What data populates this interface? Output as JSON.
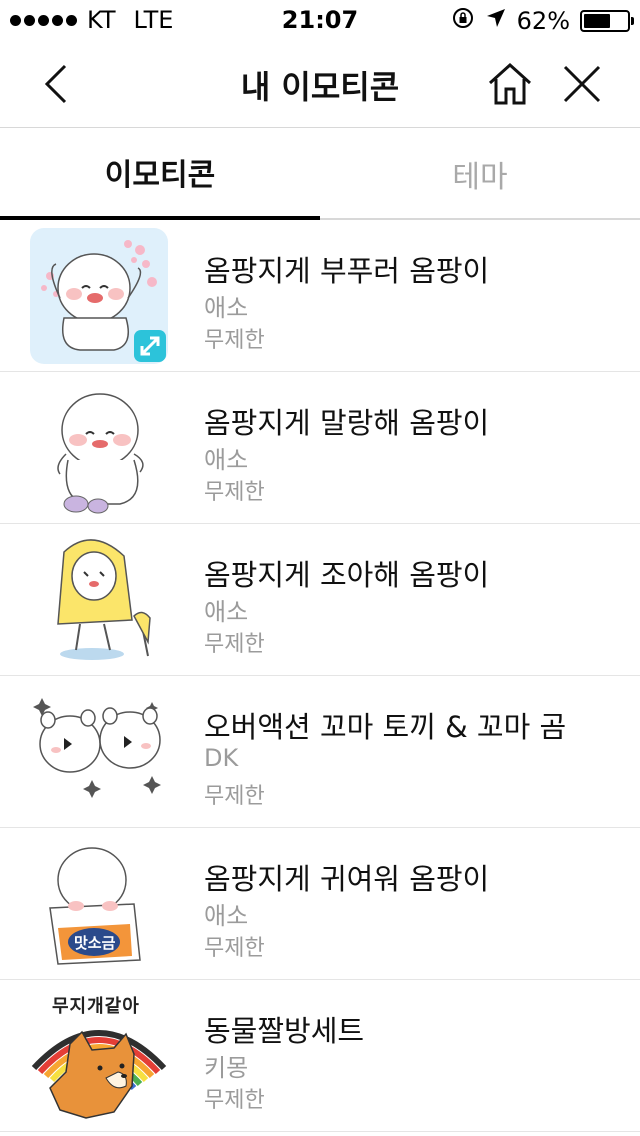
{
  "status_bar": {
    "carrier": "KT",
    "network": "LTE",
    "time": "21:07",
    "battery": "62%",
    "battery_level": 0.62
  },
  "nav": {
    "title": "내 이모티콘",
    "back_icon": "chevron-left-icon",
    "home_icon": "home-icon",
    "close_icon": "close-icon"
  },
  "tabs": [
    {
      "label": "이모티콘",
      "active": true
    },
    {
      "label": "테마",
      "active": false
    }
  ],
  "items": [
    {
      "title": "옴팡지게 부푸러 옴팡이",
      "author": "애소",
      "period": "무제한",
      "thumb": "ompang-puffed-sticker",
      "badge": "expand-icon"
    },
    {
      "title": "옴팡지게 말랑해 옴팡이",
      "author": "애소",
      "period": "무제한",
      "thumb": "ompang-soft-sticker"
    },
    {
      "title": "옴팡지게 조아해 옴팡이",
      "author": "애소",
      "period": "무제한",
      "thumb": "ompang-raincoat-sticker"
    },
    {
      "title": "오버액션 꼬마 토끼 & 꼬마 곰",
      "author": "DK",
      "period": "무제한",
      "thumb": "rabbit-bear-sticker"
    },
    {
      "title": "옴팡지게 귀여워 옴팡이",
      "author": "애소",
      "period": "무제한",
      "thumb": "ompang-bag-sticker",
      "thumb_text": "맛소금"
    },
    {
      "title": "동물짤방세트",
      "author": "키몽",
      "period": "무제한",
      "thumb": "dog-rainbow-sticker",
      "thumb_text": "무지개같아"
    }
  ],
  "colors": {
    "accent": "#000000",
    "text_primary": "#111111",
    "text_secondary": "#9b9b9b",
    "badge": "#2cc3da",
    "thumb_bg_selected": "#dff0fb"
  }
}
